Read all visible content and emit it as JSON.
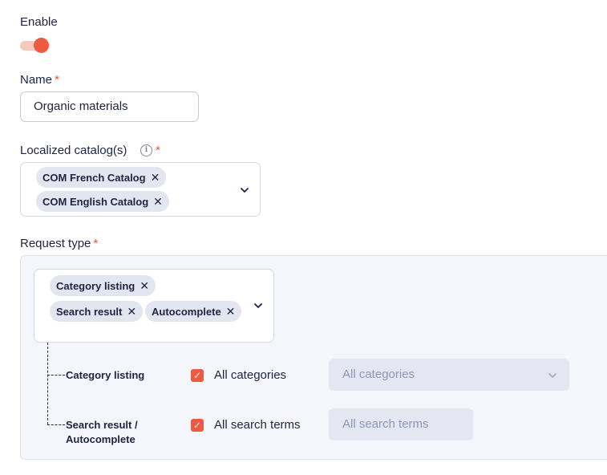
{
  "enable": {
    "label": "Enable",
    "on": true
  },
  "name": {
    "label": "Name",
    "required_mark": "*",
    "value": "Organic materials"
  },
  "catalogs": {
    "label": "Localized catalog(s)",
    "required_mark": "*",
    "info_icon": "info-icon",
    "chips": [
      "COM French Catalog",
      "COM English Catalog"
    ]
  },
  "request_type": {
    "label": "Request type",
    "required_mark": "*",
    "chips": [
      "Category listing",
      "Search result",
      "Autocomplete"
    ]
  },
  "rules": [
    {
      "label": "Category listing",
      "checkbox_label": "All categories",
      "checked": true,
      "field_placeholder": "All categories"
    },
    {
      "label_line1": "Search result /",
      "label_line2": "Autocomplete",
      "checkbox_label": "All search terms",
      "checked": true,
      "field_placeholder": "All search terms"
    }
  ],
  "colors": {
    "accent": "#ec5a42",
    "chip_bg": "#e3e6f1",
    "panel_bg": "#f4f6fc",
    "disabled_field_bg": "#e4e7f1"
  },
  "chip_remove_glyph": "✕",
  "check_glyph": "✓"
}
